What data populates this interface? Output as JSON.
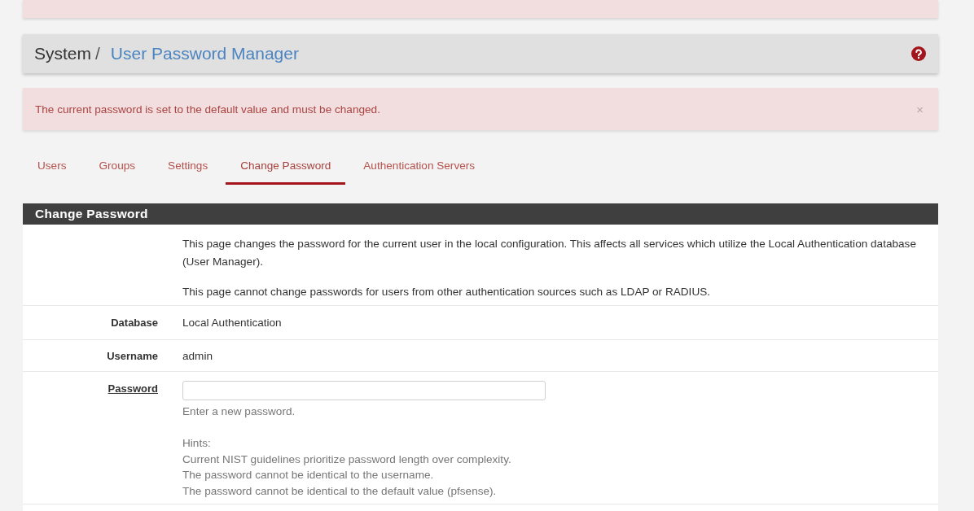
{
  "breadcrumb": {
    "parent": "System",
    "separator": "/",
    "current": "User Password Manager"
  },
  "alert": {
    "message": "The current password is set to the default value and must be changed.",
    "close": "×"
  },
  "tabs": [
    {
      "label": "Users",
      "selected": false
    },
    {
      "label": "Groups",
      "selected": false
    },
    {
      "label": "Settings",
      "selected": false
    },
    {
      "label": "Change Password",
      "selected": true
    },
    {
      "label": "Authentication Servers",
      "selected": false
    }
  ],
  "panel": {
    "title": "Change Password",
    "rows": [
      {
        "kind": "description",
        "paragraphs": [
          "This page changes the password for the current user in the local configuration. This affects all services which utilize the Local Authentication database (User Manager).",
          "This page cannot change passwords for users from other authentication sources such as LDAP or RADIUS."
        ]
      },
      {
        "kind": "static",
        "label": "Database",
        "value": "Local Authentication"
      },
      {
        "kind": "static",
        "label": "Username",
        "value": "admin"
      },
      {
        "kind": "input",
        "label": "Password",
        "required": true,
        "help": "Enter a new password.",
        "hints": {
          "title": "Hints:",
          "items": [
            "Current NIST guidelines prioritize password length over complexity.",
            "The password cannot be identical to the username.",
            "The password cannot be identical to the default value (pfsense)."
          ]
        }
      }
    ]
  }
}
